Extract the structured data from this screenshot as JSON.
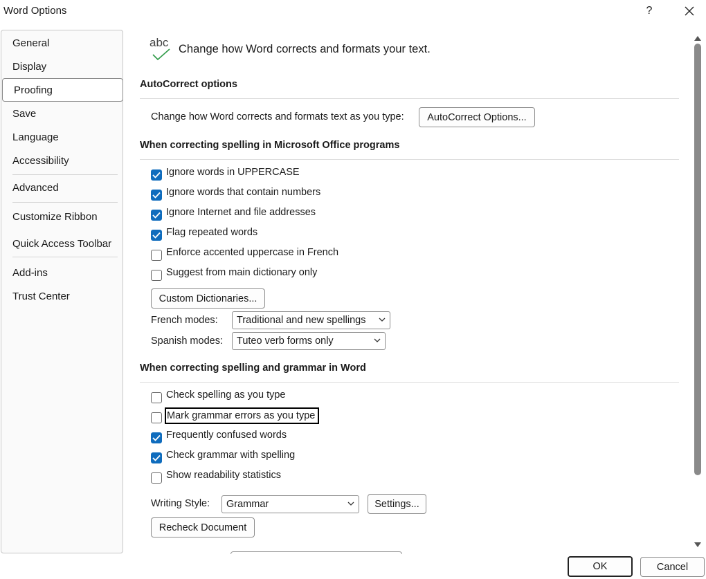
{
  "window": {
    "title": "Word Options",
    "help_label": "?",
    "close_label": "✕"
  },
  "nav": {
    "items": [
      "General",
      "Display",
      "Proofing",
      "Save",
      "Language",
      "Accessibility",
      "Advanced",
      "Customize Ribbon",
      "Quick Access Toolbar",
      "Add-ins",
      "Trust Center"
    ],
    "selected": "Proofing"
  },
  "header": {
    "icon_text": "abc",
    "text": "Change how Word corrects and formats your text."
  },
  "autocorrect": {
    "title": "AutoCorrect options",
    "label": "Change how Word corrects and formats text as you type:",
    "button": "AutoCorrect Options..."
  },
  "office_spelling": {
    "title": "When correcting spelling in Microsoft Office programs",
    "checks": [
      {
        "label": "Ignore words in UPPERCASE",
        "checked": true
      },
      {
        "label": "Ignore words that contain numbers",
        "checked": true
      },
      {
        "label": "Ignore Internet and file addresses",
        "checked": true
      },
      {
        "label": "Flag repeated words",
        "checked": true
      },
      {
        "label": "Enforce accented uppercase in French",
        "checked": false
      },
      {
        "label": "Suggest from main dictionary only",
        "checked": false
      }
    ],
    "custom_dict_button": "Custom Dictionaries...",
    "french_label": "French modes:",
    "french_value": "Traditional and new spellings",
    "spanish_label": "Spanish modes:",
    "spanish_value": "Tuteo verb forms only"
  },
  "word_grammar": {
    "title": "When correcting spelling and grammar in Word",
    "checks": [
      {
        "label": "Check spelling as you type",
        "checked": false
      },
      {
        "label": "Mark grammar errors as you type",
        "checked": false
      },
      {
        "label": "Frequently confused words",
        "checked": true
      },
      {
        "label": "Check grammar with spelling",
        "checked": true
      },
      {
        "label": "Show readability statistics",
        "checked": false
      }
    ],
    "writing_style_label": "Writing Style:",
    "writing_style_value": "Grammar",
    "settings_button": "Settings...",
    "recheck_button": "Recheck Document"
  },
  "footer": {
    "ok": "OK",
    "cancel": "Cancel"
  },
  "colors": {
    "accent": "#0f6cbd",
    "check_green": "#2e9a47"
  }
}
